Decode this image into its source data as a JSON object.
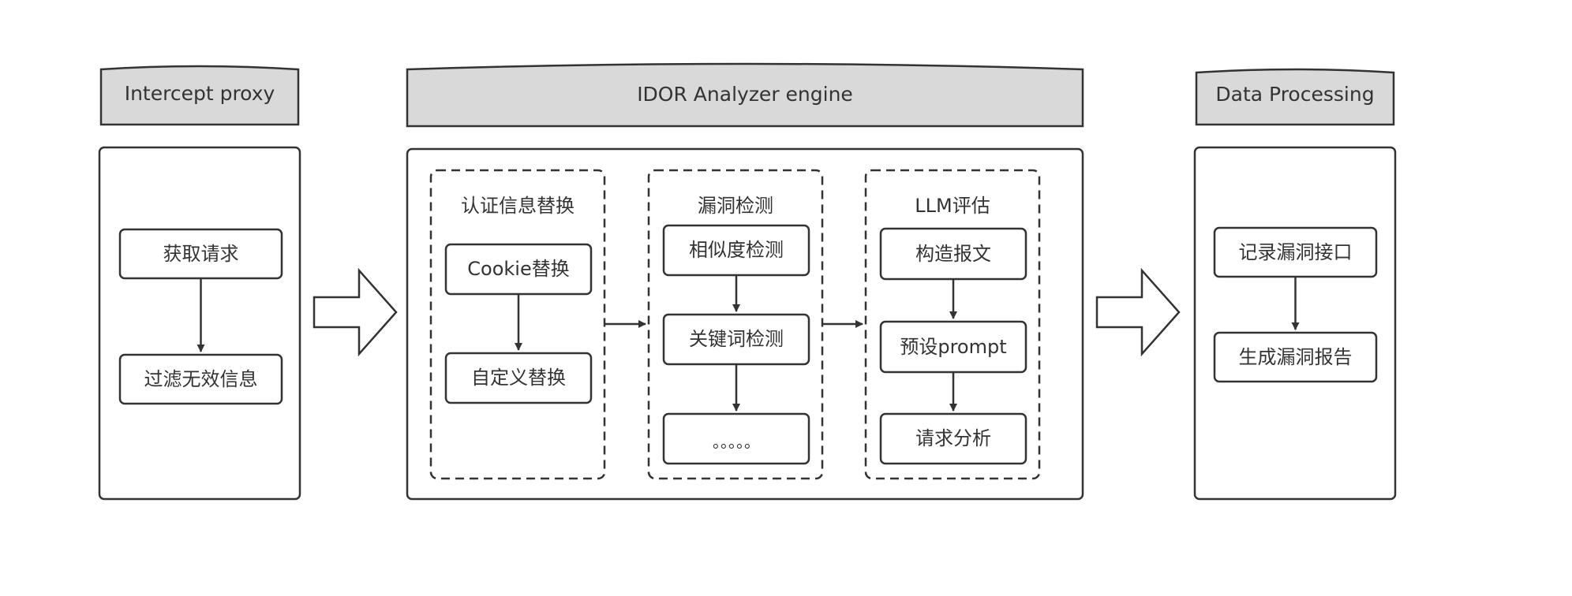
{
  "colors": {
    "stroke": "#333333",
    "header_fill": "#d9d9d9",
    "box_fill": "#ffffff",
    "text": "#333333"
  },
  "sections": {
    "proxy": {
      "header": "Intercept proxy",
      "nodes": {
        "get_request": "获取请求",
        "filter_info": "过滤无效信息"
      }
    },
    "engine": {
      "header": "IDOR Analyzer engine",
      "groups": {
        "auth": {
          "title": "认证信息替换",
          "nodes": {
            "cookie": "Cookie替换",
            "custom": "自定义替换"
          }
        },
        "vuln": {
          "title": "漏洞检测",
          "nodes": {
            "similarity": "相似度检测",
            "keyword": "关键词检测",
            "more": "。。。。。"
          }
        },
        "llm": {
          "title": "LLM评估",
          "nodes": {
            "construct": "构造报文",
            "prompt": "预设prompt",
            "analysis": "请求分析"
          }
        }
      }
    },
    "processing": {
      "header": "Data Processing",
      "nodes": {
        "record": "记录漏洞接口",
        "report": "生成漏洞报告"
      }
    }
  }
}
